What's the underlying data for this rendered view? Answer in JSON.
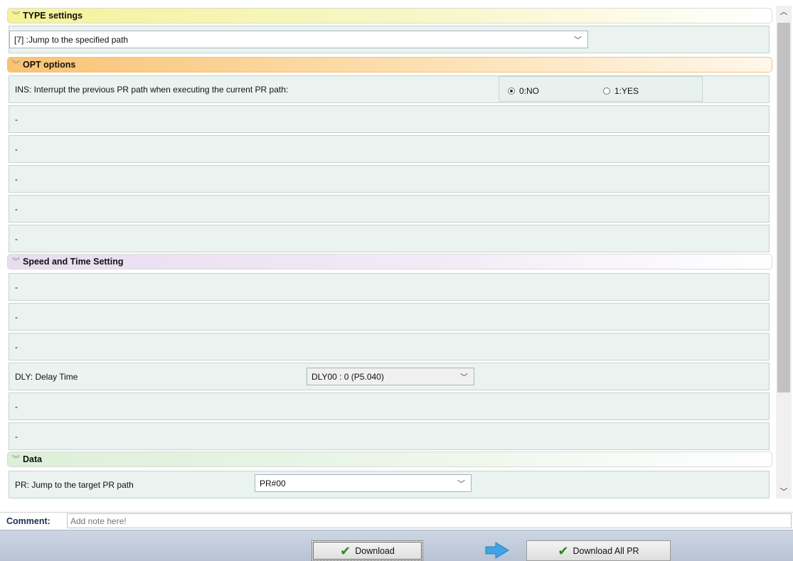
{
  "sections": {
    "type_settings": "TYPE settings",
    "opt_options": "OPT options",
    "speed_time": "Speed and Time Setting",
    "data": "Data"
  },
  "type_select": {
    "value": "[7] :Jump to the specified path"
  },
  "opt": {
    "ins_label": "INS: Interrupt the previous PR path when executing the current PR path:",
    "radio_no": "0:NO",
    "radio_yes": "1:YES",
    "selected": "0:NO",
    "empty_rows": [
      "-",
      "-",
      "-",
      "-",
      "-"
    ]
  },
  "speed": {
    "empty_rows_top": [
      "-",
      "-",
      "-"
    ],
    "dly_label": "DLY: Delay Time",
    "dly_value": "DLY00 : 0 (P5.040)",
    "empty_rows_bottom": [
      "-",
      "-"
    ]
  },
  "data_section": {
    "pr_label": "PR: Jump to the target PR path",
    "pr_value": "PR#00"
  },
  "comment": {
    "label": "Comment:",
    "placeholder": "Add note here!"
  },
  "buttons": {
    "download": "Download",
    "download_all": "Download All PR"
  },
  "icons": {
    "section_chevron": "double-chevron-down-icon",
    "select_arrow": "chevron-down-icon",
    "check": "check-icon",
    "arrow": "right-arrow-icon"
  },
  "colors": {
    "row_bg": "#eaf3ef",
    "type_header": "#f4f39a",
    "opt_header": "#f9c374",
    "speed_header": "#e9dcf0",
    "data_header": "#dcefd8",
    "check_green": "#2d8a1f",
    "arrow_blue": "#3fa3e6"
  }
}
